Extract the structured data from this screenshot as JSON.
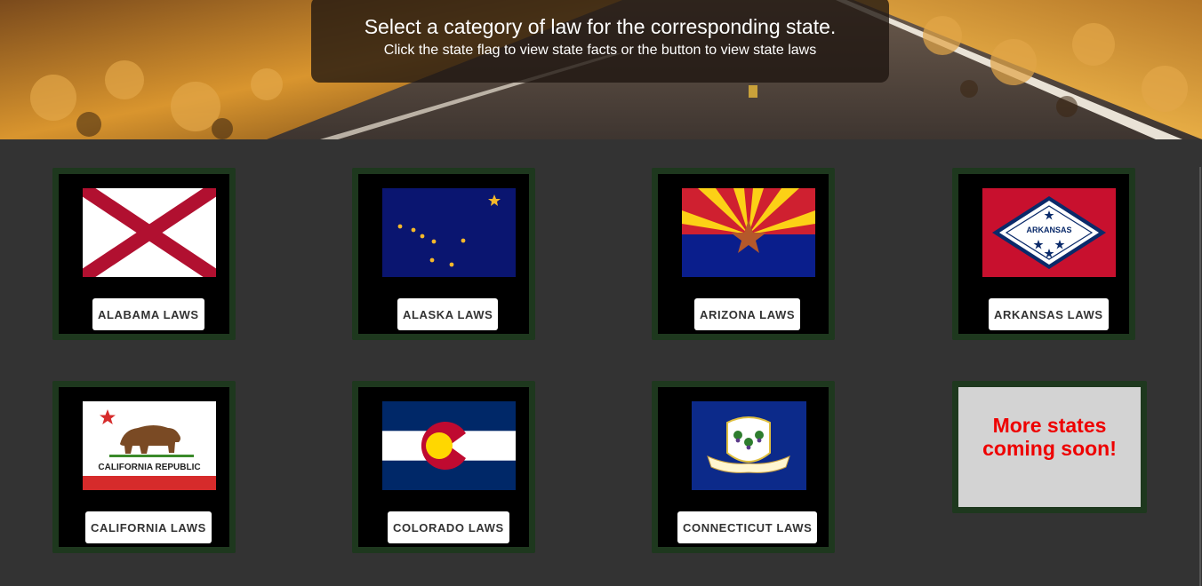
{
  "header": {
    "title": "Select a category of law for the corresponding state.",
    "subtitle": "Click the state flag to view state facts or the button to view state laws"
  },
  "states": [
    {
      "name": "Alabama",
      "flag_icon": "alabama-flag-icon",
      "button_label": "ALABAMA LAWS"
    },
    {
      "name": "Alaska",
      "flag_icon": "alaska-flag-icon",
      "button_label": "ALASKA LAWS"
    },
    {
      "name": "Arizona",
      "flag_icon": "arizona-flag-icon",
      "button_label": "ARIZONA LAWS"
    },
    {
      "name": "Arkansas",
      "flag_icon": "arkansas-flag-icon",
      "button_label": "ARKANSAS LAWS",
      "flag_text": "ARKANSAS"
    },
    {
      "name": "California",
      "flag_icon": "california-flag-icon",
      "button_label": "CALIFORNIA LAWS",
      "flag_text": "CALIFORNIA REPUBLIC"
    },
    {
      "name": "Colorado",
      "flag_icon": "colorado-flag-icon",
      "button_label": "COLORADO LAWS"
    },
    {
      "name": "Connecticut",
      "flag_icon": "connecticut-flag-icon",
      "button_label": "CONNECTICUT LAWS"
    }
  ],
  "coming_soon": {
    "line1": "More states",
    "line2": "coming soon!"
  },
  "colors": {
    "page_background": "#333333",
    "card_border": "#1e381e",
    "card_background": "#000000",
    "button_background": "#ffffff",
    "button_text": "#333333",
    "coming_soon_background": "#d3d3d3",
    "coming_soon_text": "#ee0000"
  }
}
